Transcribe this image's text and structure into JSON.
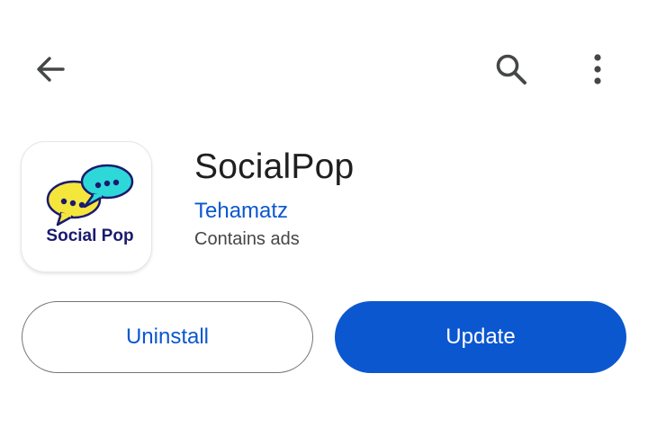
{
  "toolbar": {
    "back_icon": "arrow-back-icon",
    "search_icon": "search-icon",
    "more_icon": "more-vertical-icon"
  },
  "app": {
    "title": "SocialPop",
    "developer": "Tehamatz",
    "ads_note": "Contains ads",
    "icon_text": "Social Pop"
  },
  "actions": {
    "uninstall_label": "Uninstall",
    "update_label": "Update"
  },
  "colors": {
    "accent": "#0b57d0",
    "title_text": "#1f1f1f",
    "secondary_text": "#444746",
    "bubble_yellow": "#f5e63c",
    "bubble_cyan": "#2fd8d8",
    "icon_navy": "#1a1a6e"
  }
}
